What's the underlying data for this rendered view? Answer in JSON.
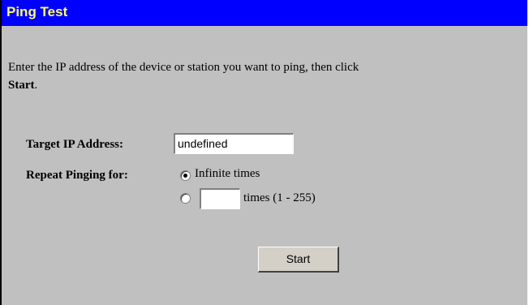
{
  "header": {
    "title": "Ping Test"
  },
  "intro": {
    "text": "Enter the IP address of the device or station you want to ping, then click",
    "bold": "Start",
    "suffix": "."
  },
  "form": {
    "target_label": "Target IP Address:",
    "target_value": "undefined",
    "repeat_label": "Repeat Pinging for:",
    "option_infinite": "Infinite times",
    "option_infinite_selected": true,
    "option_times_value": "",
    "option_times_suffix": "times (1 - 255)"
  },
  "actions": {
    "start_label": "Start"
  },
  "colors": {
    "header_bg": "#0000ff",
    "header_text": "#ffff66",
    "panel_bg": "#c0c0c0"
  }
}
